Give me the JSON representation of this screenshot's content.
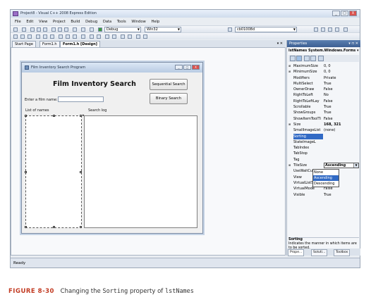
{
  "window": {
    "title": "Project8 - Visual C++ 2008 Express Edition",
    "min": "_",
    "max": "□",
    "close": "X"
  },
  "menu": [
    "File",
    "Edit",
    "View",
    "Project",
    "Build",
    "Debug",
    "Data",
    "Tools",
    "Window",
    "Help"
  ],
  "toolbar": {
    "config": "Debug",
    "platform": "Win32",
    "find_value": "cb01008d"
  },
  "tabs": {
    "start_page": "Start Page",
    "form_code": "Form1.h",
    "form_design": "Form1.h [Design]",
    "close": "▾ ✕"
  },
  "form": {
    "caption": "Film Inventory Search Program",
    "heading": "Film Inventory Search",
    "sequential_button": "Sequential Search",
    "binary_button": "Binary Search",
    "film_label": "Enter a film name:",
    "list_label": "List of names",
    "log_label": "Search log"
  },
  "properties": {
    "panel_title": "Properties",
    "panel_controls": "▾ ⊓ ✕",
    "object": "lstNames System.Windows.Forms ▾",
    "rows": [
      {
        "k": "MaximumSize",
        "v": "0, 0",
        "exp": "⊞"
      },
      {
        "k": "MinimumSize",
        "v": "0, 0",
        "exp": "⊞"
      },
      {
        "k": "Modifiers",
        "v": "Private"
      },
      {
        "k": "MultiSelect",
        "v": "True"
      },
      {
        "k": "OwnerDraw",
        "v": "False"
      },
      {
        "k": "RightToLeft",
        "v": "No"
      },
      {
        "k": "RightToLeftLay",
        "v": "False"
      },
      {
        "k": "Scrollable",
        "v": "True"
      },
      {
        "k": "ShowGroups",
        "v": "True"
      },
      {
        "k": "ShowItemToolTi",
        "v": "False"
      },
      {
        "k": "Size",
        "v": "168, 321",
        "exp": "⊞",
        "bold": true
      },
      {
        "k": "SmallImageList",
        "v": "(none)"
      },
      {
        "k": "Sorting",
        "v": "",
        "sel": true
      },
      {
        "k": "StateImageL",
        "v": ""
      },
      {
        "k": "TabIndex",
        "v": ""
      },
      {
        "k": "TabStop",
        "v": ""
      },
      {
        "k": "Tag",
        "v": ""
      },
      {
        "k": "TileSize",
        "v": "0, 0",
        "exp": "⊞"
      },
      {
        "k": "UseWaitCursor",
        "v": "False"
      },
      {
        "k": "View",
        "v": "List",
        "bold": true
      },
      {
        "k": "VirtualListSize",
        "v": "0"
      },
      {
        "k": "VirtualMode",
        "v": "False"
      },
      {
        "k": "Visible",
        "v": "True"
      }
    ],
    "sorting_value": "Ascending",
    "sorting_options": [
      "None",
      "Ascending",
      "Descending"
    ],
    "sorting_highlight": "Ascending",
    "desc_title": "Sorting",
    "desc_text": "Indicates the manner in which items are to be sorted.",
    "bottom_tabs": [
      "Prope...",
      "Soluti...",
      "Toolbox"
    ]
  },
  "status": "Ready",
  "caption": {
    "figure": "FIGURE 8-30",
    "text_a": "Changing the ",
    "code_a": "Sorting",
    "text_b": " property of ",
    "code_b": "lstNames"
  }
}
